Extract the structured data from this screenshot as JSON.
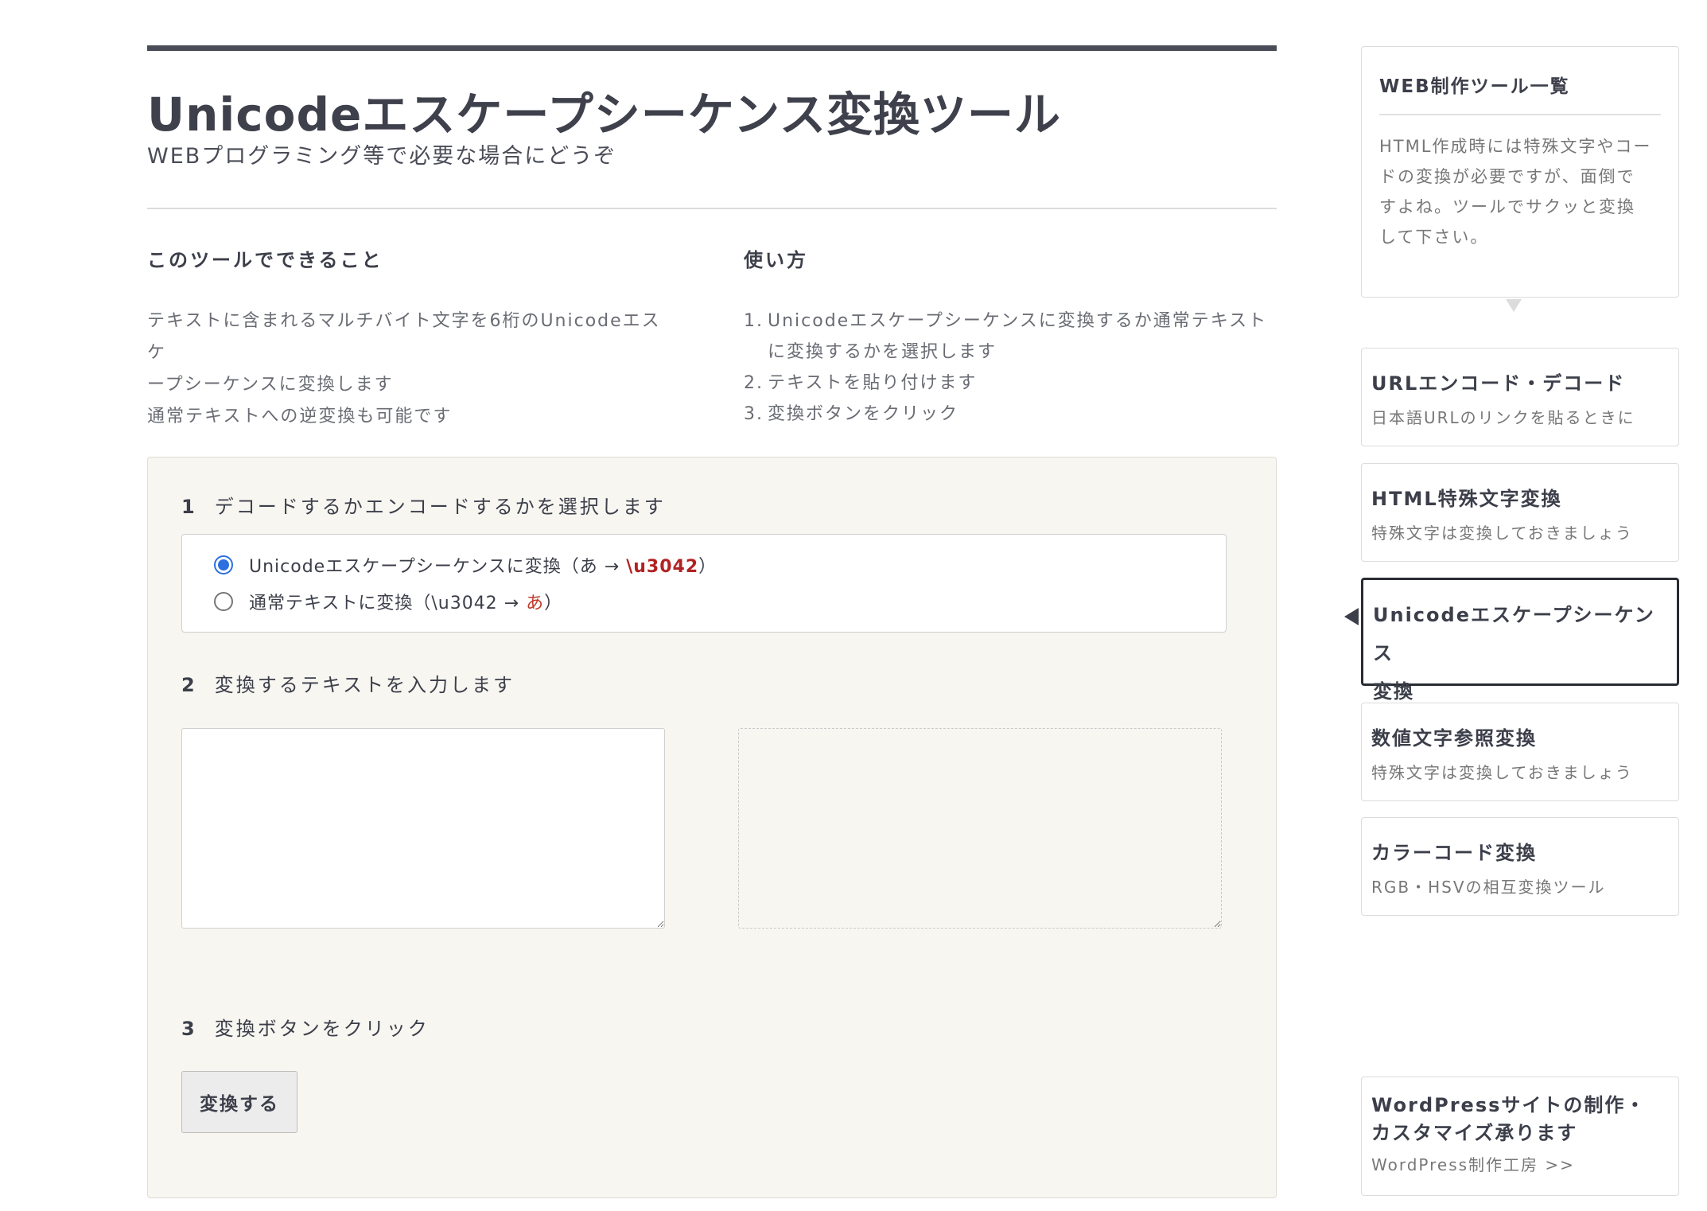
{
  "page": {
    "title": "Unicodeエスケープシーケンス変換ツール",
    "subtitle": "WEBプログラミング等で必要な場合にどうぞ"
  },
  "about": {
    "heading": "このツールでできること",
    "lines": [
      "テキストに含まれるマルチバイト文字を6桁のUnicodeエスケ",
      "ープシーケンスに変換します",
      "通常テキストへの逆変換も可能です"
    ]
  },
  "usage": {
    "heading": "使い方",
    "steps": [
      {
        "num": "1.",
        "lines": [
          "Unicodeエスケープシーケンスに変換するか通常テキスト",
          "に変換するかを選択します"
        ]
      },
      {
        "num": "2.",
        "lines": [
          "テキストを貼り付けます"
        ]
      },
      {
        "num": "3.",
        "lines": [
          "変換ボタンをクリック"
        ]
      }
    ]
  },
  "tool": {
    "step1": {
      "num": "1",
      "label": "デコードするかエンコードするかを選択します"
    },
    "options": [
      {
        "prefix": "Unicodeエスケープシーケンスに変換（あ → ",
        "highlight": "\\u3042",
        "suffix": "）",
        "checked": true
      },
      {
        "prefix": "通常テキストに変換（\\u3042 → ",
        "highlight": "あ",
        "suffix": "）",
        "checked": false
      }
    ],
    "step2": {
      "num": "2",
      "label": "変換するテキストを入力します"
    },
    "input_value": "",
    "output_value": "",
    "step3": {
      "num": "3",
      "label": "変換ボタンをクリック"
    },
    "button_label": "変換する"
  },
  "sidebar": {
    "header": {
      "title": "WEB制作ツール一覧",
      "desc": [
        "HTML作成時には特殊文字やコー",
        "ドの変換が必要ですが、面倒で",
        "すよね。ツールでサクッと変換",
        "して下さい。"
      ]
    },
    "items": [
      {
        "title": "URLエンコード・デコード",
        "sub": "日本語URLのリンクを貼るときに"
      },
      {
        "title": "HTML特殊文字変換",
        "sub": "特殊文字は変換しておきましょう"
      },
      {
        "title_lines": [
          "Unicodeエスケープシーケンス",
          "変換"
        ],
        "active": true
      },
      {
        "title": "数値文字参照変換",
        "sub": "特殊文字は変換しておきましょう"
      },
      {
        "title": "カラーコード変換",
        "sub": "RGB・HSVの相互変換ツール"
      }
    ],
    "promo": {
      "title_lines": [
        "WordPressサイトの制作・",
        "カスタマイズ承ります"
      ],
      "link": "WordPress制作工房 >>"
    }
  },
  "colors": {
    "accent_red": "#c0392b",
    "radio_blue": "#2b6fe0",
    "panel_bg": "#f7f6f1"
  }
}
